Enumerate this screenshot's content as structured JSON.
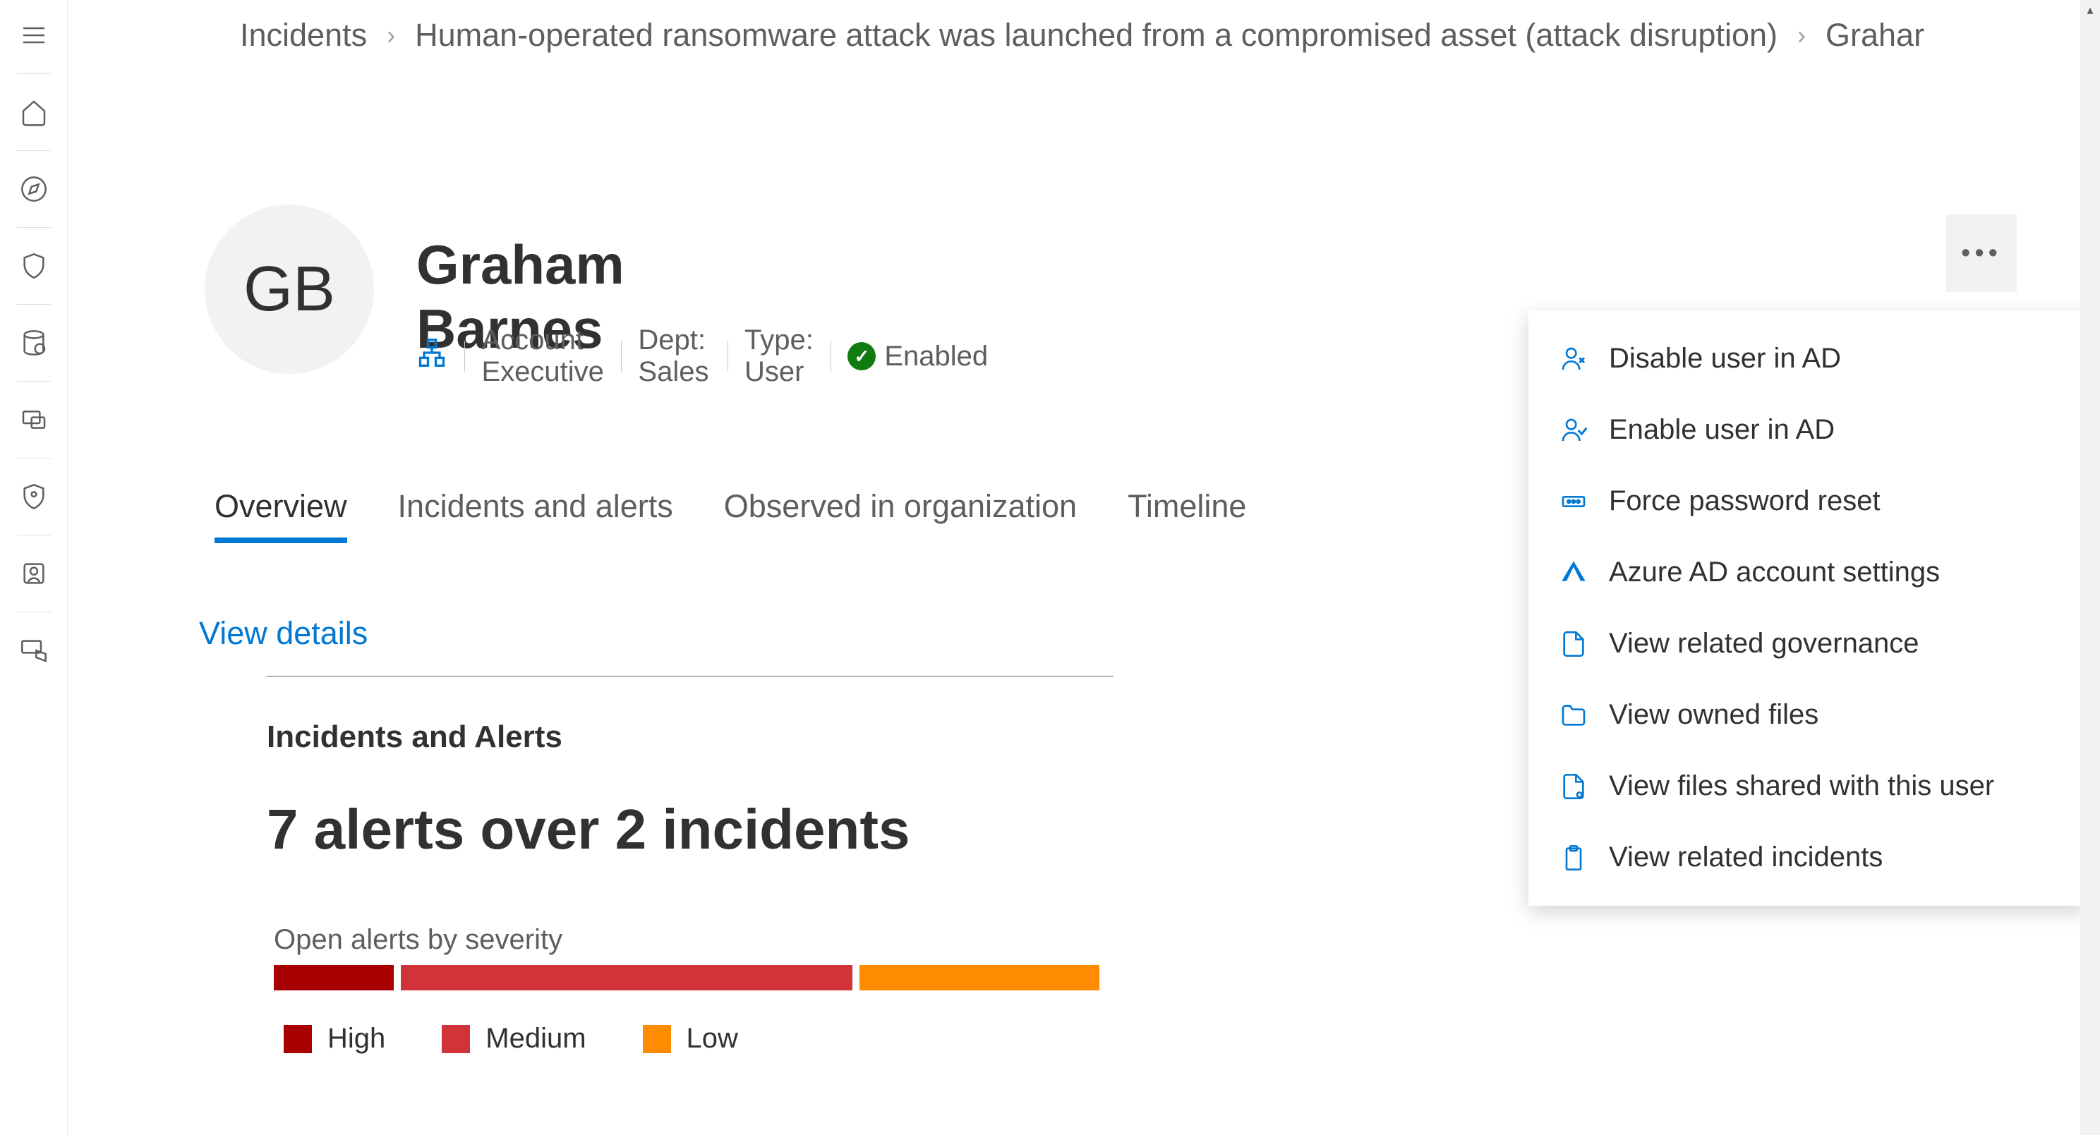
{
  "breadcrumb": {
    "incidents": "Incidents",
    "incident_name": "Human-operated ransomware attack was launched from a compromised asset (attack disruption)",
    "user_short": "Grahar"
  },
  "user": {
    "initials": "GB",
    "full_name": "Graham Barnes",
    "role": "Account Executive",
    "dept": "Dept: Sales",
    "type": "Type: User",
    "status": "Enabled"
  },
  "tabs": {
    "overview": "Overview",
    "incidents": "Incidents and alerts",
    "observed": "Observed in organization",
    "timeline": "Timeline"
  },
  "links": {
    "view_details": "View details"
  },
  "card": {
    "title": "Incidents and Alerts",
    "stat": "7 alerts over 2 incidents",
    "severity_label": "Open alerts by severity"
  },
  "legend": {
    "high": "High",
    "medium": "Medium",
    "low": "Low"
  },
  "menu": {
    "disable": "Disable user in AD",
    "enable": "Enable user in AD",
    "reset": "Force password reset",
    "aad": "Azure AD account settings",
    "governance": "View related governance",
    "owned": "View owned files",
    "shared": "View files shared with this user",
    "incidents": "View related incidents"
  },
  "chart_data": {
    "type": "bar",
    "title": "Open alerts by severity",
    "categories": [
      "High",
      "Medium",
      "Low"
    ],
    "values": [
      1,
      4,
      2
    ],
    "total_alerts": 7,
    "total_incidents": 2,
    "colors": {
      "High": "#a80000",
      "Medium": "#d13438",
      "Low": "#ff8c00"
    }
  }
}
